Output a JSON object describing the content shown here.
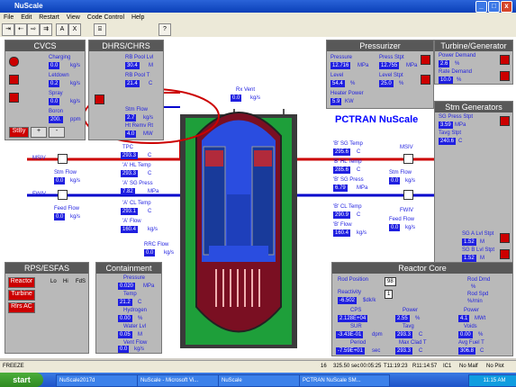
{
  "window": {
    "title": "NuScale",
    "min": "_",
    "max": "□",
    "close": "x"
  },
  "menu": [
    "File",
    "Edit",
    "Restart",
    "View",
    "Code Control",
    "Help"
  ],
  "toolbar": [
    "⇥",
    "⇠",
    "⇨",
    "⇉",
    "A",
    "X",
    "⌸",
    "?"
  ],
  "main_title": "PCTRAN NuScale",
  "cvcs": {
    "title": "CVCS",
    "rows": [
      {
        "label": "Charging",
        "value": "0.0",
        "unit": "kg/s"
      },
      {
        "label": "Letdown",
        "value": "0.2",
        "unit": "kg/s"
      },
      {
        "label": "Spray",
        "value": "0.0",
        "unit": "kg/s"
      },
      {
        "label": "Boron",
        "value": "200.",
        "unit": "ppm"
      }
    ],
    "buttons": [
      "StBy",
      "+",
      "-"
    ]
  },
  "dhrs": {
    "title": "DHRS/CHRS",
    "rows": [
      {
        "label": "RB Pool Lvl",
        "value": "30.4",
        "unit": "M"
      },
      {
        "label": "RB Pool T",
        "value": "21.4",
        "unit": "C"
      },
      {
        "label": "Stm Flow",
        "value": "2.7",
        "unit": "kg/s"
      },
      {
        "label": "Ht Remv Rt",
        "value": "4.0",
        "unit": "MW"
      }
    ]
  },
  "rx_vent": {
    "label": "Rx Vent",
    "value": "0.0",
    "unit": "kg/s"
  },
  "core_center": [
    {
      "label": "TPC",
      "value": "293.3",
      "unit": "C"
    },
    {
      "label": "'A' HL Temp",
      "value": "293.3",
      "unit": "C"
    },
    {
      "label": "'A' SG Press",
      "value": "7.82",
      "unit": "MPa"
    },
    {
      "label": "'A' CL Temp",
      "value": "293.1",
      "unit": "C"
    },
    {
      "label": "'A' Flow",
      "value": "160.4",
      "unit": "kg/s"
    }
  ],
  "rrc_flow": {
    "label": "RRC Flow",
    "value": "0.0",
    "unit": "kg/s"
  },
  "msiv_left": {
    "label": "MSIV"
  },
  "stm_flow_left": {
    "label": "Stm Flow",
    "value": "0.0",
    "unit": "kg/s"
  },
  "fwiv_left": {
    "label": "FWIV"
  },
  "feed_flow_left": {
    "label": "Feed Flow",
    "value": "0.0",
    "unit": "kg/s"
  },
  "sg_right": [
    {
      "label": "'B' SG Temp",
      "value": "295.6",
      "unit": "C"
    },
    {
      "label": "'B' HL Temp",
      "value": "285.6",
      "unit": "C"
    },
    {
      "label": "'B' SG Press",
      "value": "6.79",
      "unit": "MPa"
    },
    {
      "label": "'B' CL Temp",
      "value": "290.9",
      "unit": "C"
    },
    {
      "label": "'B' Flow",
      "value": "160.4",
      "unit": "kg/s"
    }
  ],
  "msiv_right": {
    "label": "MSIV"
  },
  "stm_flow_right": {
    "label": "Stm Flow",
    "value": "0.0",
    "unit": "kg/s"
  },
  "fwiv_right": {
    "label": "FWIV"
  },
  "feed_flow_right": {
    "label": "Feed Flow",
    "value": "0.0",
    "unit": "kg/s"
  },
  "pressurizer": {
    "title": "Pressurizer",
    "rows": [
      {
        "label": "Pressure",
        "value": "12.716",
        "unit": "MPa"
      },
      {
        "label": "Press Stpt",
        "value": "12.755",
        "unit": "MPa"
      },
      {
        "label": "Level",
        "value": "54.4",
        "unit": "%"
      },
      {
        "label": "Level Stpt",
        "value": "25.0",
        "unit": "%"
      },
      {
        "label": "Heater Power",
        "value": "5.9",
        "unit": "KW"
      }
    ]
  },
  "turbine": {
    "title": "Turbine/Generator",
    "rows": [
      {
        "label": "Power Demand",
        "value": "2.6",
        "unit": "%"
      },
      {
        "label": "Rate Demand",
        "value": "10.0",
        "unit": "%"
      }
    ]
  },
  "steam_gen": {
    "title": "Stm Generators",
    "rows": [
      {
        "label": "SG Press Stpt",
        "value": "3.59",
        "unit": "MPa"
      },
      {
        "label": "Tavg Stpt",
        "value": "240.6",
        "unit": "C"
      }
    ],
    "levels": [
      {
        "label": "SG A Lvl Stpt",
        "value": "1.52",
        "unit": "M"
      },
      {
        "label": "SG B Lvl Stpt",
        "value": "1.52",
        "unit": "M"
      }
    ]
  },
  "rps": {
    "title": "RPS/ESFAS",
    "buttons": [
      "Reactor",
      "Turbine",
      "Rlrs AC"
    ],
    "cols": [
      "Lo",
      "Hi",
      "FdS"
    ]
  },
  "containment": {
    "title": "Containment",
    "rows": [
      {
        "label": "Pressure",
        "value": "0.020",
        "unit": "MPa"
      },
      {
        "label": "Temp",
        "value": "21.2",
        "unit": "C"
      },
      {
        "label": "Hydrogen",
        "value": "0.00",
        "unit": "%"
      },
      {
        "label": "Water Lvl",
        "value": "0.05",
        "unit": "M"
      },
      {
        "label": "Vent Flow",
        "value": "0.0",
        "unit": "kg/s"
      }
    ]
  },
  "reactor_core": {
    "title": "Reactor Core",
    "rod_position": {
      "label": "Rod Position",
      "value": "98"
    },
    "rod_dmd": {
      "label": "Rod Dmd",
      "unit": "%"
    },
    "reactivity": {
      "label": "Reactivity",
      "value": "-6.502",
      "unit": "$dk/k"
    },
    "rod_spd": {
      "label": "Rod Spd",
      "value": "1",
      "unit": "%/min"
    },
    "cps": {
      "label": "CPS",
      "value": "2.128E+04"
    },
    "power1": {
      "label": "Power",
      "value": "2.55",
      "unit": "%"
    },
    "power2": {
      "label": "Power",
      "value": "4.1",
      "unit": "MWt"
    },
    "sur": {
      "label": "SUR",
      "value": "-3.43E-01",
      "unit": "dpm"
    },
    "tavg": {
      "label": "Tavg",
      "value": "293.3",
      "unit": "C"
    },
    "voids": {
      "label": "Voids",
      "value": "0.00",
      "unit": "%"
    },
    "period": {
      "label": "Period",
      "value": "-7.59E+01",
      "unit": "sec"
    },
    "max_clad": {
      "label": "Max Clad T",
      "value": "293.3",
      "unit": "C"
    },
    "avg_fuel": {
      "label": "Avg Fuel T",
      "value": "306.8",
      "unit": "C"
    }
  },
  "status": {
    "state": "FREEZE",
    "speed": "16",
    "time": "325.50 sec",
    "clock": "00:05:25",
    "t1": "T11:19:23",
    "t2": "R11:14:57",
    "ic": "IC1",
    "mode": "No Malf",
    "plot": "No Plot"
  },
  "taskbar": {
    "start": "start",
    "tasks": [
      "NuScale2017d",
      "NuScale - Microsoft Vi...",
      "NuScale",
      "PCTRAN NuScale SM..."
    ],
    "time": "11:15 AM"
  },
  "colors": {
    "accent": "#1f1fe0",
    "panel": "#b9b9b9",
    "highlight": "#cc0000"
  }
}
